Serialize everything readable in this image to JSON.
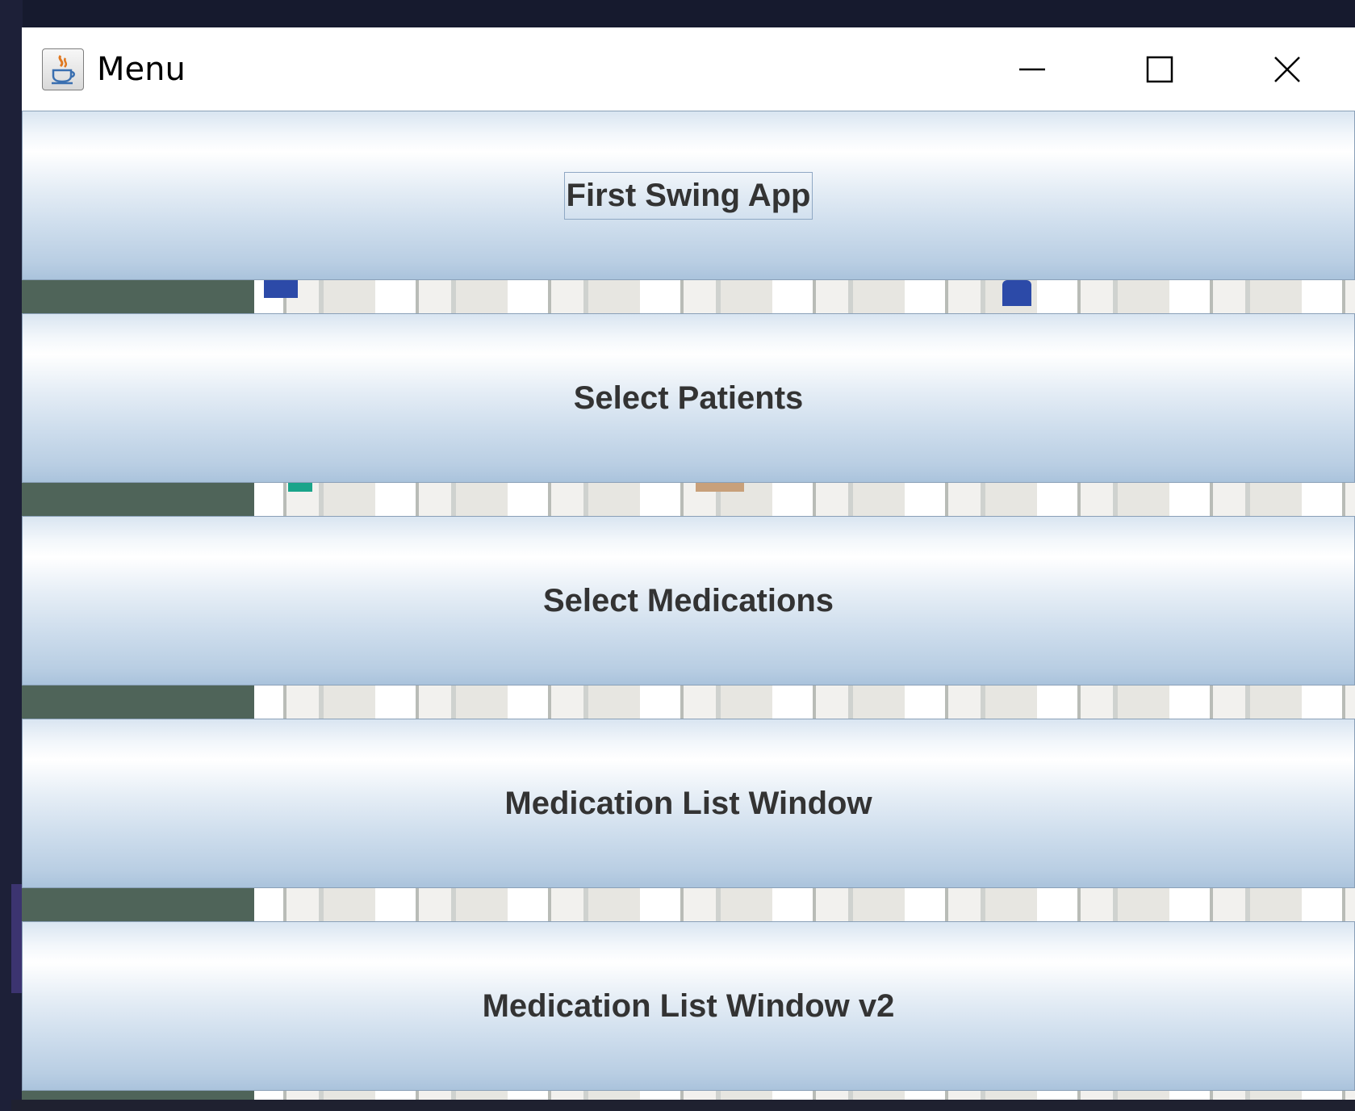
{
  "window": {
    "title": "Menu",
    "app_icon": "java-coffee-cup-icon",
    "controls": [
      "minimize-icon",
      "maximize-icon",
      "close-icon"
    ]
  },
  "menu": {
    "buttons": [
      {
        "label": "First Swing App",
        "focused": true
      },
      {
        "label": "Select Patients",
        "focused": false
      },
      {
        "label": "Select Medications",
        "focused": false
      },
      {
        "label": "Medication List Window",
        "focused": false
      },
      {
        "label": "Medication List Window v2",
        "focused": false
      }
    ]
  },
  "colors": {
    "button_top": "#ffffff",
    "button_bottom": "#aac3dc",
    "button_text": "#333333",
    "background_image_dark": "#4f6459"
  }
}
